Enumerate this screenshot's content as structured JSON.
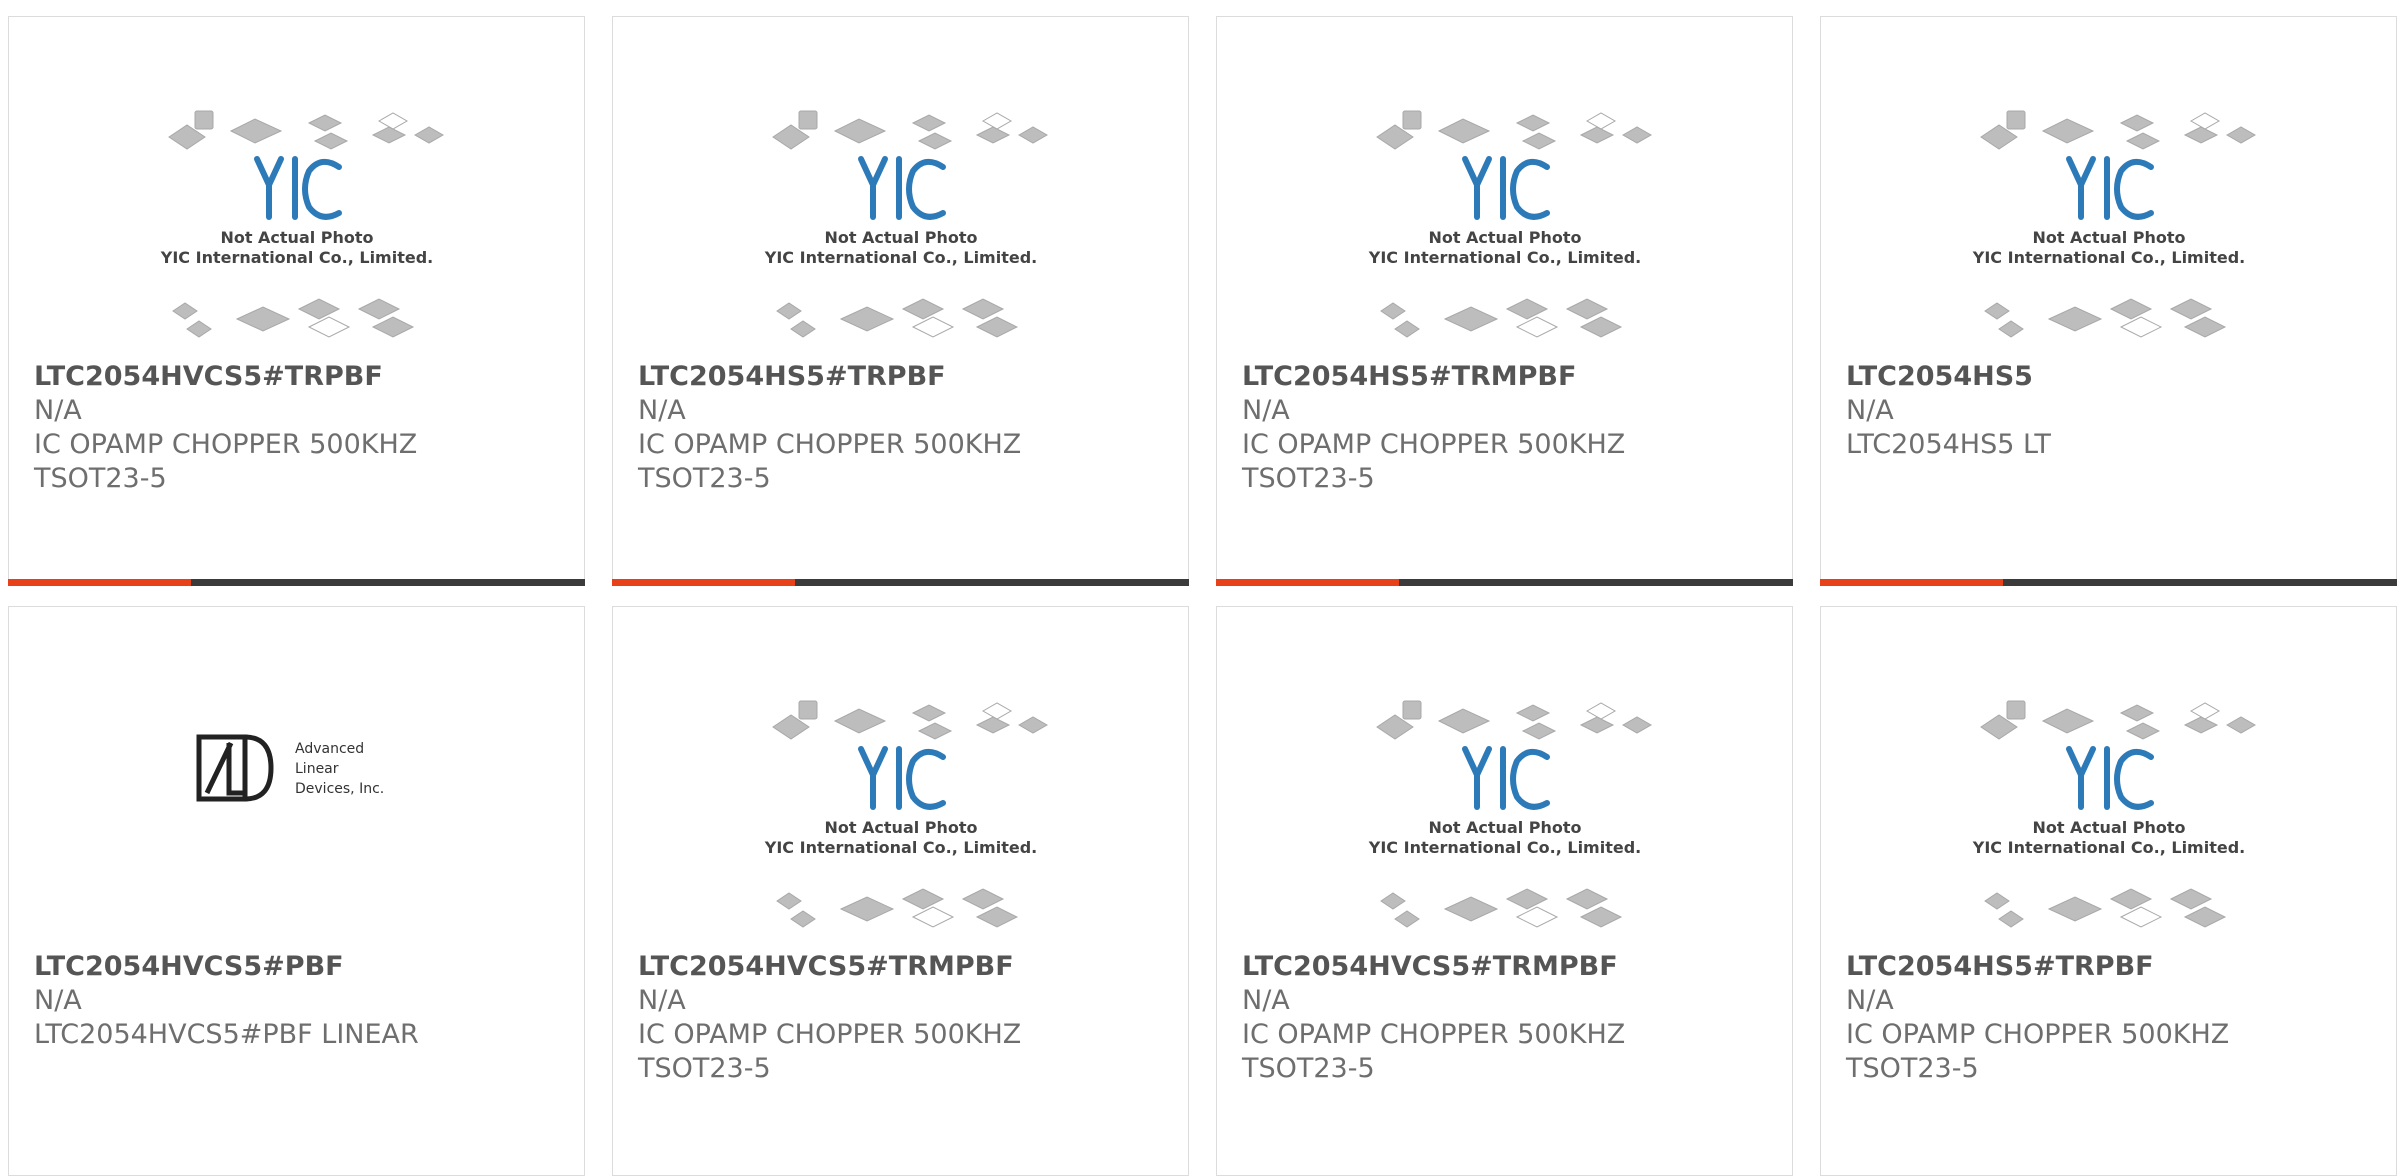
{
  "image_overlay": {
    "line1": "Not Actual Photo",
    "line2": "YIC International Co., Limited.",
    "logo_text": "YIC"
  },
  "adi_logo": {
    "line1": "Advanced",
    "line2": "Linear",
    "line3": "Devices, Inc."
  },
  "accent_colors": {
    "progress": "#e8411a",
    "track": "#3b3b3b"
  },
  "products": [
    {
      "part": "LTC2054HVCS5#TRPBF",
      "status": "N/A",
      "desc1": "IC OPAMP CHOPPER 500KHZ",
      "desc2": "TSOT23-5"
    },
    {
      "part": "LTC2054HS5#TRPBF",
      "status": "N/A",
      "desc1": "IC OPAMP CHOPPER 500KHZ",
      "desc2": "TSOT23-5"
    },
    {
      "part": "LTC2054HS5#TRMPBF",
      "status": "N/A",
      "desc1": "IC OPAMP CHOPPER 500KHZ",
      "desc2": "TSOT23-5"
    },
    {
      "part": "LTC2054HS5",
      "status": "N/A",
      "desc1": "LTC2054HS5 LT",
      "desc2": ""
    },
    {
      "part": "LTC2054HVCS5#PBF",
      "status": "N/A",
      "desc1": "LTC2054HVCS5#PBF LINEAR",
      "desc2": ""
    },
    {
      "part": "LTC2054HVCS5#TRMPBF",
      "status": "N/A",
      "desc1": "IC OPAMP CHOPPER 500KHZ",
      "desc2": "TSOT23-5"
    },
    {
      "part": "LTC2054HVCS5#TRMPBF",
      "status": "N/A",
      "desc1": "IC OPAMP CHOPPER 500KHZ",
      "desc2": "TSOT23-5"
    },
    {
      "part": "LTC2054HS5#TRPBF",
      "status": "N/A",
      "desc1": "IC OPAMP CHOPPER 500KHZ",
      "desc2": "TSOT23-5"
    }
  ]
}
